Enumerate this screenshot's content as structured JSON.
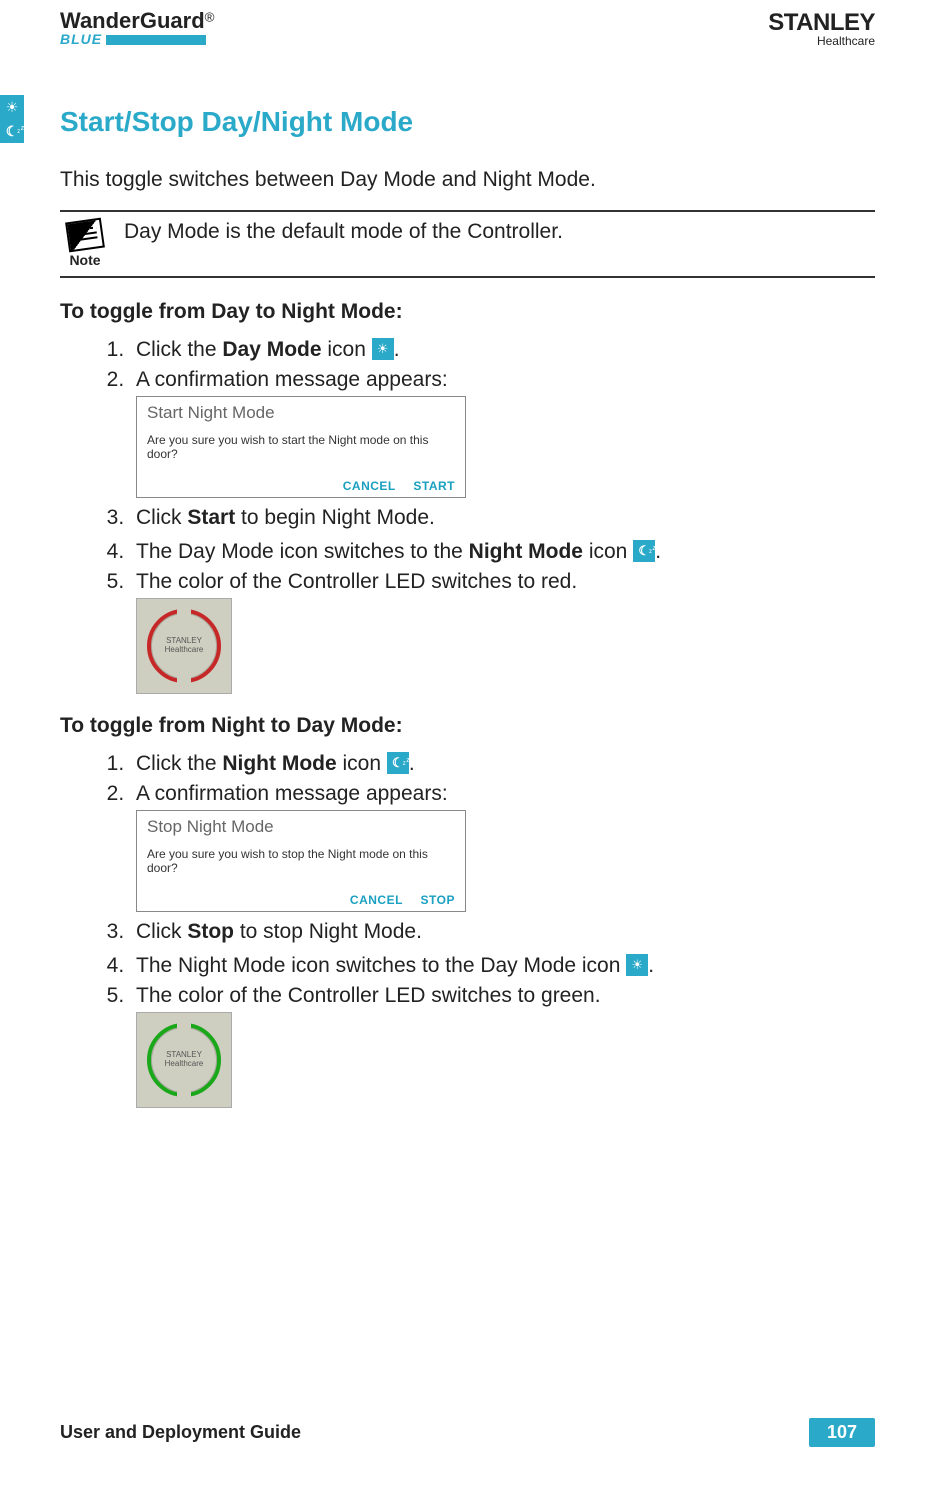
{
  "header": {
    "brand_main": "WanderGuard",
    "brand_reg": "®",
    "brand_sub": "BLUE",
    "right_brand": "STANLEY",
    "right_sub": "Healthcare"
  },
  "title": "Start/Stop Day/Night Mode",
  "intro": "This toggle switches between Day Mode and Night Mode.",
  "note": {
    "label": "Note",
    "text": "Day Mode is the default mode of the Controller."
  },
  "section_a": {
    "heading": "To toggle from Day to Night Mode:",
    "step1_a": "Click the ",
    "step1_bold": "Day Mode",
    "step1_b": " icon ",
    "step1_c": ".",
    "step2": "A confirmation message appears:",
    "dialog": {
      "title": "Start Night Mode",
      "body": "Are you sure you wish to start the Night mode on this door?",
      "cancel": "CANCEL",
      "action": "START"
    },
    "step3_a": "Click ",
    "step3_bold": "Start",
    "step3_b": " to begin Night Mode.",
    "step4_a": "The Day Mode icon switches to the ",
    "step4_bold": "Night Mode",
    "step4_b": " icon ",
    "step4_c": ".",
    "step5": "The color of the Controller LED switches to red.",
    "device_label_top": "STANLEY",
    "device_label_bottom": "Healthcare"
  },
  "section_b": {
    "heading": "To toggle from Night to Day Mode:",
    "step1_a": "Click the ",
    "step1_bold": "Night Mode",
    "step1_b": " icon ",
    "step1_c": ".",
    "step2": "A confirmation message appears:",
    "dialog": {
      "title": "Stop Night Mode",
      "body": "Are you sure you wish to stop the Night mode on this door?",
      "cancel": "CANCEL",
      "action": "STOP"
    },
    "step3_a": "Click ",
    "step3_bold": "Stop",
    "step3_b": " to stop Night Mode.",
    "step4_a": "The Night Mode icon switches to the Day Mode icon ",
    "step4_c": ".",
    "step5": "The color of the Controller LED switches to green.",
    "device_label_top": "STANLEY",
    "device_label_bottom": "Healthcare"
  },
  "footer": {
    "title": "User and Deployment Guide",
    "page": "107"
  }
}
